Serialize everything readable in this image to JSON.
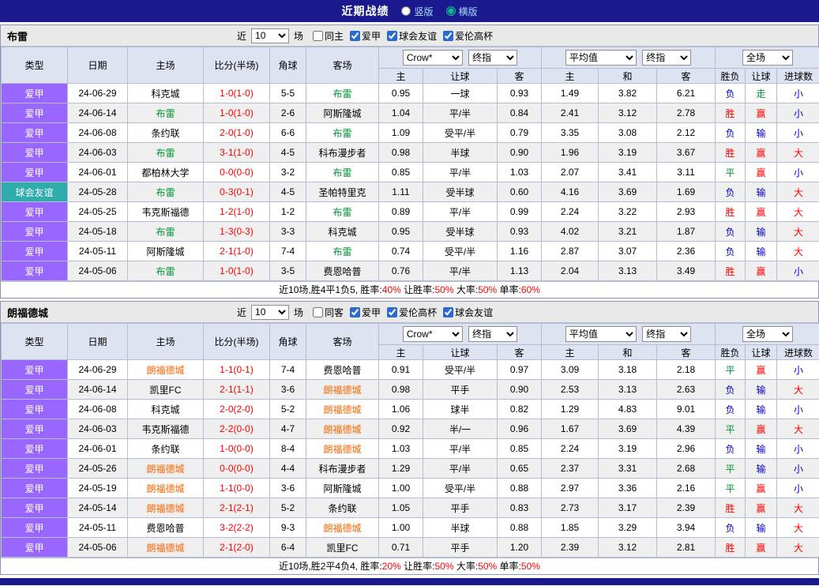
{
  "top_bar": {
    "title": "近期战绩",
    "layout_options": [
      {
        "label": "竖版",
        "selected": false
      },
      {
        "label": "横版",
        "selected": true
      }
    ]
  },
  "table_headers": {
    "type": "类型",
    "date": "日期",
    "home": "主场",
    "score": "比分(半场)",
    "corners": "角球",
    "away": "客场",
    "sub": [
      "主",
      "让球",
      "客",
      "主",
      "和",
      "客",
      "胜负",
      "让球",
      "进球数"
    ]
  },
  "colors": {
    "top_bar_bg": "#1a1a8e",
    "header_bg": "#dde3f1",
    "row_alt_bg": "#efefef",
    "section_header_bg": "#e9e9e9",
    "score": "#ff0000",
    "league": {
      "爱甲": "#9966ff",
      "球会友谊": "#2fadad"
    },
    "outcome": {
      "胜": "#ff0000",
      "平": "#009933",
      "负": "#0000cc"
    },
    "handicap_result": {
      "赢": "#ff0000",
      "输": "#0000cc",
      "走": "#009933"
    },
    "goals": {
      "大": "#ff0000",
      "小": "#0000cc"
    }
  },
  "sections": [
    {
      "team": "布雷",
      "self_color": "#009933",
      "filter": {
        "near_label": "近",
        "count": "10",
        "games_label": "场",
        "checkboxes": [
          {
            "label": "同主",
            "checked": false
          },
          {
            "label": "爱甲",
            "checked": true
          },
          {
            "label": "球会友谊",
            "checked": true
          },
          {
            "label": "爱伦高杯",
            "checked": true
          }
        ]
      },
      "dropdowns": {
        "bookmaker": "Crow*",
        "odds1": "终指",
        "average": "平均值",
        "odds2": "终指",
        "period": "全场"
      },
      "rows": [
        {
          "league": "爱甲",
          "date": "24-06-29",
          "home": "科克城",
          "score": "1-0(1-0)",
          "corners": "5-5",
          "away": "布雷",
          "let_home": "0.95",
          "handicap": "一球",
          "let_away": "0.93",
          "eu_home": "1.49",
          "eu_draw": "3.82",
          "eu_away": "6.21",
          "outcome": "负",
          "let_result": "走",
          "goals": "小"
        },
        {
          "league": "爱甲",
          "date": "24-06-14",
          "home": "布雷",
          "score": "1-0(1-0)",
          "corners": "2-6",
          "away": "阿斯隆城",
          "let_home": "1.04",
          "handicap": "平/半",
          "let_away": "0.84",
          "eu_home": "2.41",
          "eu_draw": "3.12",
          "eu_away": "2.78",
          "outcome": "胜",
          "let_result": "赢",
          "goals": "小"
        },
        {
          "league": "爱甲",
          "date": "24-06-08",
          "home": "条约联",
          "score": "2-0(1-0)",
          "corners": "6-6",
          "away": "布雷",
          "let_home": "1.09",
          "handicap": "受平/半",
          "let_away": "0.79",
          "eu_home": "3.35",
          "eu_draw": "3.08",
          "eu_away": "2.12",
          "outcome": "负",
          "let_result": "输",
          "goals": "小"
        },
        {
          "league": "爱甲",
          "date": "24-06-03",
          "home": "布雷",
          "score": "3-1(1-0)",
          "corners": "4-5",
          "away": "科布漫步者",
          "let_home": "0.98",
          "handicap": "半球",
          "let_away": "0.90",
          "eu_home": "1.96",
          "eu_draw": "3.19",
          "eu_away": "3.67",
          "outcome": "胜",
          "let_result": "赢",
          "goals": "大"
        },
        {
          "league": "爱甲",
          "date": "24-06-01",
          "home": "都柏林大学",
          "score": "0-0(0-0)",
          "corners": "3-2",
          "away": "布雷",
          "let_home": "0.85",
          "handicap": "平/半",
          "let_away": "1.03",
          "eu_home": "2.07",
          "eu_draw": "3.41",
          "eu_away": "3.11",
          "outcome": "平",
          "let_result": "赢",
          "goals": "小"
        },
        {
          "league": "球会友谊",
          "date": "24-05-28",
          "home": "布雷",
          "score": "0-3(0-1)",
          "corners": "4-5",
          "away": "圣帕特里克",
          "let_home": "1.11",
          "handicap": "受半球",
          "let_away": "0.60",
          "eu_home": "4.16",
          "eu_draw": "3.69",
          "eu_away": "1.69",
          "outcome": "负",
          "let_result": "输",
          "goals": "大"
        },
        {
          "league": "爱甲",
          "date": "24-05-25",
          "home": "韦克斯福德",
          "score": "1-2(1-0)",
          "corners": "1-2",
          "away": "布雷",
          "let_home": "0.89",
          "handicap": "平/半",
          "let_away": "0.99",
          "eu_home": "2.24",
          "eu_draw": "3.22",
          "eu_away": "2.93",
          "outcome": "胜",
          "let_result": "赢",
          "goals": "大"
        },
        {
          "league": "爱甲",
          "date": "24-05-18",
          "home": "布雷",
          "score": "1-3(0-3)",
          "corners": "3-3",
          "away": "科克城",
          "let_home": "0.95",
          "handicap": "受半球",
          "let_away": "0.93",
          "eu_home": "4.02",
          "eu_draw": "3.21",
          "eu_away": "1.87",
          "outcome": "负",
          "let_result": "输",
          "goals": "大"
        },
        {
          "league": "爱甲",
          "date": "24-05-11",
          "home": "阿斯隆城",
          "score": "2-1(1-0)",
          "corners": "7-4",
          "away": "布雷",
          "let_home": "0.74",
          "handicap": "受平/半",
          "let_away": "1.16",
          "eu_home": "2.87",
          "eu_draw": "3.07",
          "eu_away": "2.36",
          "outcome": "负",
          "let_result": "输",
          "goals": "大"
        },
        {
          "league": "爱甲",
          "date": "24-05-06",
          "home": "布雷",
          "score": "1-0(1-0)",
          "corners": "3-5",
          "away": "费恩哈普",
          "let_home": "0.76",
          "handicap": "平/半",
          "let_away": "1.13",
          "eu_home": "2.04",
          "eu_draw": "3.13",
          "eu_away": "3.49",
          "outcome": "胜",
          "let_result": "赢",
          "goals": "小"
        }
      ],
      "summary": [
        {
          "text": "近10场,胜4平1负5, 胜率:",
          "red": false
        },
        {
          "text": "40%",
          "red": true
        },
        {
          "text": " 让胜率:",
          "red": false
        },
        {
          "text": "50%",
          "red": true
        },
        {
          "text": " 大率:",
          "red": false
        },
        {
          "text": "50%",
          "red": true
        },
        {
          "text": " 单率:",
          "red": false
        },
        {
          "text": "60%",
          "red": true
        }
      ]
    },
    {
      "team": "朗福德城",
      "self_color": "#ff6600",
      "filter": {
        "near_label": "近",
        "count": "10",
        "games_label": "场",
        "checkboxes": [
          {
            "label": "同客",
            "checked": false
          },
          {
            "label": "爱甲",
            "checked": true
          },
          {
            "label": "爱伦高杯",
            "checked": true
          },
          {
            "label": "球会友谊",
            "checked": true
          }
        ]
      },
      "dropdowns": {
        "bookmaker": "Crow*",
        "odds1": "终指",
        "average": "平均值",
        "odds2": "终指",
        "period": "全场"
      },
      "rows": [
        {
          "league": "爱甲",
          "date": "24-06-29",
          "home": "朗福德城",
          "score": "1-1(0-1)",
          "corners": "7-4",
          "away": "费恩哈普",
          "let_home": "0.91",
          "handicap": "受平/半",
          "let_away": "0.97",
          "eu_home": "3.09",
          "eu_draw": "3.18",
          "eu_away": "2.18",
          "outcome": "平",
          "let_result": "赢",
          "goals": "小"
        },
        {
          "league": "爱甲",
          "date": "24-06-14",
          "home": "凯里FC",
          "score": "2-1(1-1)",
          "corners": "3-6",
          "away": "朗福德城",
          "let_home": "0.98",
          "handicap": "平手",
          "let_away": "0.90",
          "eu_home": "2.53",
          "eu_draw": "3.13",
          "eu_away": "2.63",
          "outcome": "负",
          "let_result": "输",
          "goals": "大"
        },
        {
          "league": "爱甲",
          "date": "24-06-08",
          "home": "科克城",
          "score": "2-0(2-0)",
          "corners": "5-2",
          "away": "朗福德城",
          "let_home": "1.06",
          "handicap": "球半",
          "let_away": "0.82",
          "eu_home": "1.29",
          "eu_draw": "4.83",
          "eu_away": "9.01",
          "outcome": "负",
          "let_result": "输",
          "goals": "小"
        },
        {
          "league": "爱甲",
          "date": "24-06-03",
          "home": "韦克斯福德",
          "score": "2-2(0-0)",
          "corners": "4-7",
          "away": "朗福德城",
          "let_home": "0.92",
          "handicap": "半/一",
          "let_away": "0.96",
          "eu_home": "1.67",
          "eu_draw": "3.69",
          "eu_away": "4.39",
          "outcome": "平",
          "let_result": "赢",
          "goals": "大"
        },
        {
          "league": "爱甲",
          "date": "24-06-01",
          "home": "条约联",
          "score": "1-0(0-0)",
          "corners": "8-4",
          "away": "朗福德城",
          "let_home": "1.03",
          "handicap": "平/半",
          "let_away": "0.85",
          "eu_home": "2.24",
          "eu_draw": "3.19",
          "eu_away": "2.96",
          "outcome": "负",
          "let_result": "输",
          "goals": "小"
        },
        {
          "league": "爱甲",
          "date": "24-05-26",
          "home": "朗福德城",
          "score": "0-0(0-0)",
          "corners": "4-4",
          "away": "科布漫步者",
          "let_home": "1.29",
          "handicap": "平/半",
          "let_away": "0.65",
          "eu_home": "2.37",
          "eu_draw": "3.31",
          "eu_away": "2.68",
          "outcome": "平",
          "let_result": "输",
          "goals": "小"
        },
        {
          "league": "爱甲",
          "date": "24-05-19",
          "home": "朗福德城",
          "score": "1-1(0-0)",
          "corners": "3-6",
          "away": "阿斯隆城",
          "let_home": "1.00",
          "handicap": "受平/半",
          "let_away": "0.88",
          "eu_home": "2.97",
          "eu_draw": "3.36",
          "eu_away": "2.16",
          "outcome": "平",
          "let_result": "赢",
          "goals": "小"
        },
        {
          "league": "爱甲",
          "date": "24-05-14",
          "home": "朗福德城",
          "score": "2-1(2-1)",
          "corners": "5-2",
          "away": "条约联",
          "let_home": "1.05",
          "handicap": "平手",
          "let_away": "0.83",
          "eu_home": "2.73",
          "eu_draw": "3.17",
          "eu_away": "2.39",
          "outcome": "胜",
          "let_result": "赢",
          "goals": "大"
        },
        {
          "league": "爱甲",
          "date": "24-05-11",
          "home": "费恩哈普",
          "score": "3-2(2-2)",
          "corners": "9-3",
          "away": "朗福德城",
          "let_home": "1.00",
          "handicap": "半球",
          "let_away": "0.88",
          "eu_home": "1.85",
          "eu_draw": "3.29",
          "eu_away": "3.94",
          "outcome": "负",
          "let_result": "输",
          "goals": "大"
        },
        {
          "league": "爱甲",
          "date": "24-05-06",
          "home": "朗福德城",
          "score": "2-1(2-0)",
          "corners": "6-4",
          "away": "凯里FC",
          "let_home": "0.71",
          "handicap": "平手",
          "let_away": "1.20",
          "eu_home": "2.39",
          "eu_draw": "3.12",
          "eu_away": "2.81",
          "outcome": "胜",
          "let_result": "赢",
          "goals": "大"
        }
      ],
      "summary": [
        {
          "text": "近10场,胜2平4负4, 胜率:",
          "red": false
        },
        {
          "text": "20%",
          "red": true
        },
        {
          "text": " 让胜率:",
          "red": false
        },
        {
          "text": "50%",
          "red": true
        },
        {
          "text": " 大率:",
          "red": false
        },
        {
          "text": "50%",
          "red": true
        },
        {
          "text": " 单率:",
          "red": false
        },
        {
          "text": "50%",
          "red": true
        }
      ]
    }
  ]
}
